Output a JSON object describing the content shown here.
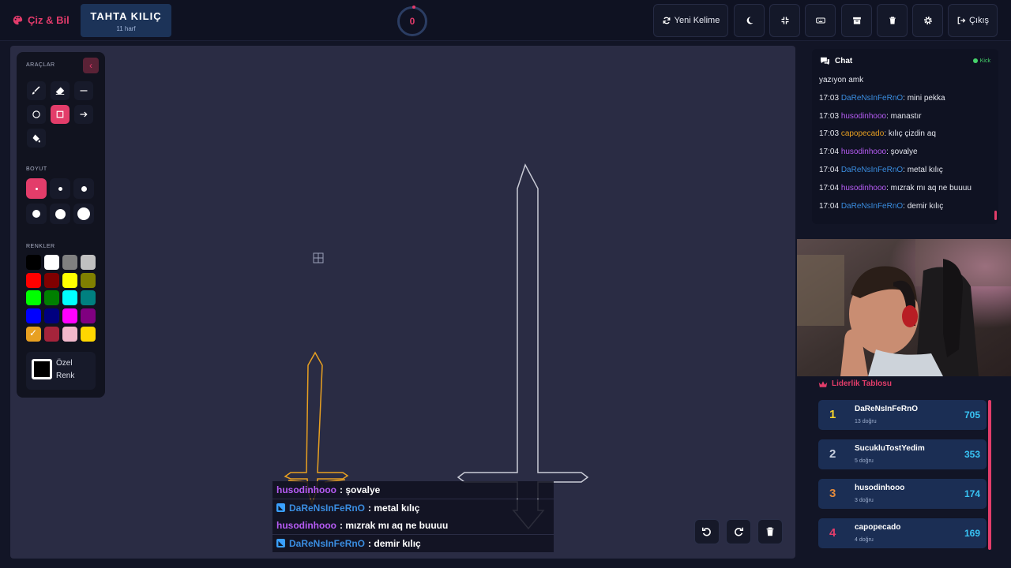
{
  "app": {
    "logo_text": "Çiz & Bil"
  },
  "word": {
    "text": "TAHTA KILIÇ",
    "hint": "11 harf"
  },
  "timer": {
    "value": "0"
  },
  "toolbar": {
    "new_word": "Yeni Kelime",
    "logout": "Çıkış",
    "icons": [
      "moon-icon",
      "compress-icon",
      "keyboard-icon",
      "archive-icon",
      "trash-icon",
      "gear-icon"
    ]
  },
  "tools_panel": {
    "tools_label": "ARAÇLAR",
    "size_label": "BOYUT",
    "colors_label": "RENKLER",
    "custom_color_label": "Özel Renk",
    "active_tool": "rectangle",
    "active_size_index": 0,
    "colors": [
      "#000000",
      "#ffffff",
      "#808080",
      "#c0c0c0",
      "#ff0000",
      "#800000",
      "#ffff00",
      "#808000",
      "#00ff00",
      "#008000",
      "#00ffff",
      "#008080",
      "#0000ff",
      "#000080",
      "#ff00ff",
      "#800080",
      "#e8a021",
      "#a5243b",
      "#f2b8cb",
      "#ffd700"
    ],
    "selected_color_index": 16
  },
  "feed": [
    {
      "user": "husodinhooo",
      "user_color": "#b75cf5",
      "text": ": şovalye",
      "kick": false
    },
    {
      "user": "DaReNsInFeRnO",
      "user_color": "#3a8de0",
      "text": ": metal kılıç",
      "kick": true
    },
    {
      "user": "husodinhooo",
      "user_color": "#b75cf5",
      "text": ": mızrak mı aq ne buuuu",
      "kick": false
    },
    {
      "user": "DaReNsInFeRnO",
      "user_color": "#3a8de0",
      "text": ": demir kılıç",
      "kick": true
    }
  ],
  "chat": {
    "title": "Chat",
    "platform": "Kick",
    "messages": [
      {
        "time": "",
        "user": "",
        "user_color": "#e6e8f0",
        "text": "yazıyon amk"
      },
      {
        "time": "17:03",
        "user": "DaReNsInFeRnO",
        "user_color": "#3a8de0",
        "text": ": mini pekka"
      },
      {
        "time": "17:03",
        "user": "husodinhooo",
        "user_color": "#b75cf5",
        "text": ": manastır"
      },
      {
        "time": "17:03",
        "user": "capopecado",
        "user_color": "#e8a021",
        "text": ": kılıç çizdin aq"
      },
      {
        "time": "17:04",
        "user": "husodinhooo",
        "user_color": "#b75cf5",
        "text": ": şovalye"
      },
      {
        "time": "17:04",
        "user": "DaReNsInFeRnO",
        "user_color": "#3a8de0",
        "text": ": metal kılıç"
      },
      {
        "time": "17:04",
        "user": "husodinhooo",
        "user_color": "#b75cf5",
        "text": ": mızrak mı aq ne buuuu"
      },
      {
        "time": "17:04",
        "user": "DaReNsInFeRnO",
        "user_color": "#3a8de0",
        "text": ": demir kılıç"
      }
    ]
  },
  "leaderboard": {
    "title": "Liderlik Tablosu",
    "rows": [
      {
        "rank": "1",
        "name": "DaReNsInFeRnO",
        "sub": "13 doğru",
        "score": "705",
        "rank_color": "#f5d32c"
      },
      {
        "rank": "2",
        "name": "SucukluTostYedim",
        "sub": "5 doğru",
        "score": "353",
        "rank_color": "#c9d1e0"
      },
      {
        "rank": "3",
        "name": "husodinhooo",
        "sub": "3 doğru",
        "score": "174",
        "rank_color": "#e28a3c"
      },
      {
        "rank": "4",
        "name": "capopecado",
        "sub": "4 doğru",
        "score": "169",
        "rank_color": "#e33d6a"
      }
    ]
  },
  "colors": {
    "accent": "#e33d6a",
    "score": "#39c4f5",
    "canvas": "#2a2c44"
  }
}
